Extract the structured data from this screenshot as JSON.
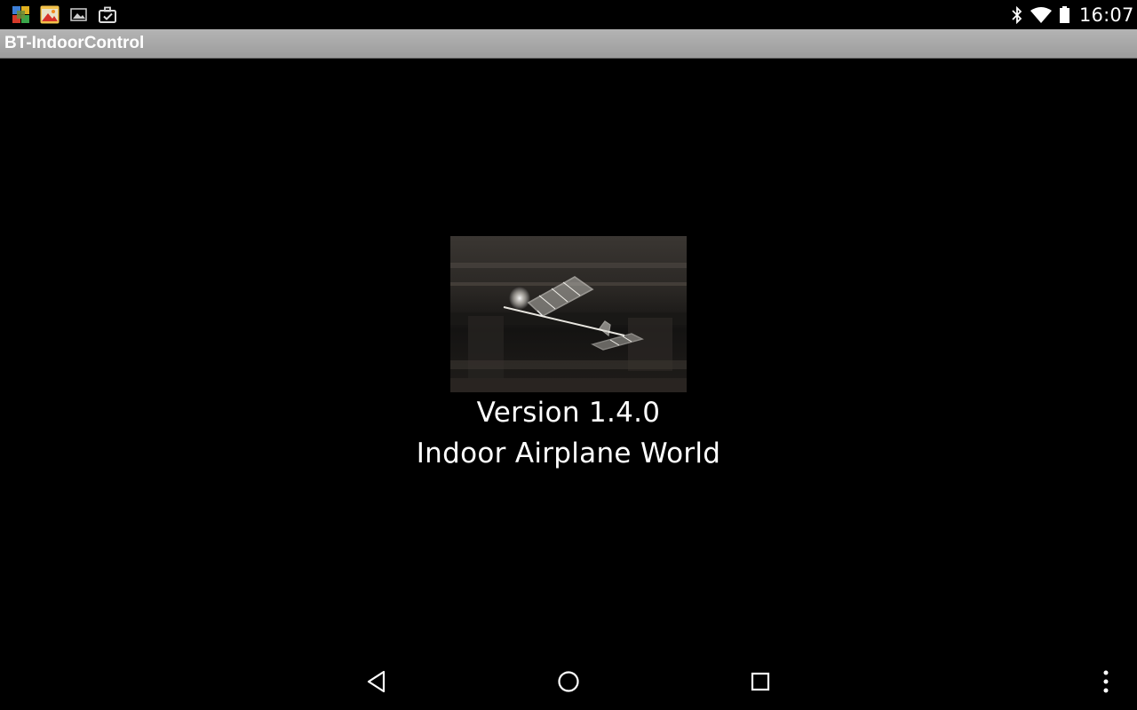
{
  "status_bar": {
    "notification_icons": [
      "color-squares-app-icon",
      "photo-app-icon",
      "image-notification-icon",
      "briefcase-check-icon"
    ],
    "system_icons": [
      "bluetooth-icon",
      "wifi-icon",
      "battery-icon"
    ],
    "clock": "16:07"
  },
  "action_bar": {
    "title": "BT-IndoorControl",
    "background": "#a9a9a9",
    "title_color": "#ffffff"
  },
  "splash": {
    "image": "indoor-airplane-photo",
    "version": "Version 1.4.0",
    "company": "Indoor Airplane World"
  },
  "nav_bar": {
    "buttons": [
      "back-icon",
      "home-icon",
      "recents-icon",
      "overflow-menu-icon"
    ]
  }
}
